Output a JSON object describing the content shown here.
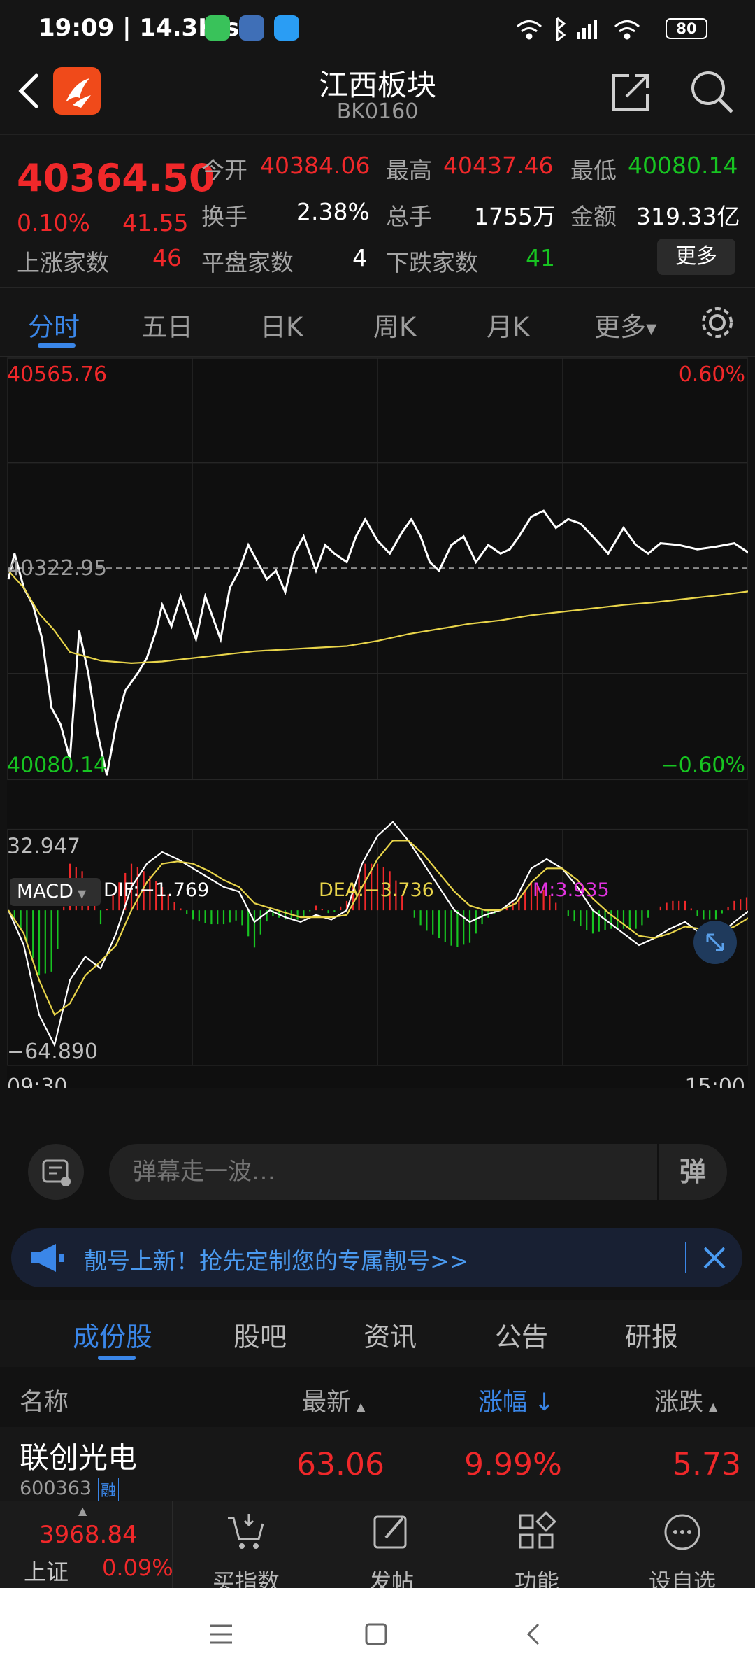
{
  "status_bar": {
    "time": "19:09 | 14.3K/s",
    "battery": "80"
  },
  "header": {
    "title": "江西板块",
    "code": "BK0160"
  },
  "quote": {
    "price": "40364.50",
    "change_pct": "0.10%",
    "change": "41.55",
    "open_label": "今开",
    "open": "40384.06",
    "high_label": "最高",
    "high": "40437.46",
    "low_label": "最低",
    "low": "40080.14",
    "turnover_label": "换手",
    "turnover": "2.38%",
    "volume_label": "总手",
    "volume": "1755万",
    "amount_label": "金额",
    "amount": "319.33亿",
    "up_label": "上涨家数",
    "up": "46",
    "flat_label": "平盘家数",
    "flat": "4",
    "down_label": "下跌家数",
    "down": "41",
    "more": "更多"
  },
  "kline_tabs": [
    "分时",
    "五日",
    "日K",
    "周K",
    "月K",
    "更多"
  ],
  "colors": {
    "up": "#f0282a",
    "down": "#17c421",
    "accent": "#3a86e8",
    "price_line": "#ffffff",
    "avg_line": "#e8d44a",
    "macd_m": "#e233e0"
  },
  "chart_data": {
    "type": "line",
    "title": "",
    "price_max_label": "40565.76",
    "price_min_label": "40080.14",
    "prev_close_label": "40322.95",
    "pct_max_label": "0.60%",
    "pct_min_label": "−0.60%",
    "ylim": [
      40080.14,
      40565.76
    ],
    "prev_close": 40322.95,
    "x_start_label": "09:30",
    "x_end_label": "15:00",
    "x_count": 241,
    "series": [
      {
        "kind": "price",
        "x": [
          0,
          2,
          5,
          8,
          11,
          14,
          17,
          20,
          23,
          26,
          29,
          32,
          35,
          38,
          42,
          45,
          48,
          50,
          53,
          56,
          58,
          61,
          64,
          66,
          69,
          72,
          75,
          78,
          81,
          84,
          87,
          90,
          93,
          96,
          100,
          103,
          106,
          110,
          113,
          116,
          120,
          124,
          128,
          131,
          134,
          137,
          140,
          144,
          148,
          152,
          156,
          160,
          163,
          166,
          170,
          174,
          178,
          182,
          186,
          190,
          195,
          200,
          204,
          208,
          212,
          218,
          224,
          230,
          236,
          241
        ],
        "values": [
          40310,
          40340,
          40300,
          40280,
          40240,
          40160,
          40140,
          40100,
          40250,
          40200,
          40130,
          40081,
          40140,
          40180,
          40200,
          40218,
          40250,
          40280,
          40255,
          40290,
          40270,
          40240,
          40290,
          40270,
          40240,
          40300,
          40320,
          40350,
          40330,
          40310,
          40320,
          40295,
          40340,
          40360,
          40320,
          40350,
          40340,
          40330,
          40360,
          40380,
          40355,
          40340,
          40365,
          40380,
          40360,
          40330,
          40320,
          40350,
          40360,
          40330,
          40350,
          40340,
          40345,
          40360,
          40383,
          40390,
          40370,
          40380,
          40375,
          40360,
          40340,
          40370,
          40350,
          40340,
          40352,
          40350,
          40345,
          40348,
          40352,
          40340
        ]
      },
      {
        "kind": "average",
        "x": [
          0,
          5,
          10,
          15,
          20,
          30,
          40,
          50,
          60,
          70,
          80,
          90,
          100,
          110,
          120,
          130,
          140,
          150,
          160,
          170,
          180,
          190,
          200,
          210,
          220,
          230,
          241
        ],
        "values": [
          40320,
          40300,
          40270,
          40250,
          40225,
          40215,
          40212,
          40214,
          40218,
          40222,
          40226,
          40228,
          40230,
          40232,
          40238,
          40246,
          40252,
          40258,
          40262,
          40268,
          40272,
          40276,
          40280,
          40283,
          40287,
          40291,
          40296
        ]
      }
    ],
    "macd": {
      "ind_name": "MACD",
      "dif_label": "DIF:−1.769",
      "dea_label": "DEA:−3.736",
      "m_label": "M:3.935",
      "max_label": "32.947",
      "min_label": "−64.890",
      "ylim": [
        -64.89,
        32.947
      ],
      "x": [
        0,
        5,
        10,
        15,
        20,
        25,
        30,
        35,
        40,
        45,
        50,
        55,
        60,
        65,
        70,
        75,
        80,
        85,
        90,
        95,
        100,
        105,
        110,
        115,
        120,
        125,
        130,
        135,
        140,
        145,
        150,
        155,
        160,
        165,
        170,
        175,
        180,
        185,
        190,
        195,
        200,
        205,
        210,
        215,
        220,
        225,
        230,
        236,
        241
      ],
      "dif": [
        0,
        -15,
        -45,
        -58,
        -30,
        -20,
        -25,
        -10,
        10,
        20,
        25,
        22,
        18,
        14,
        10,
        8,
        -5,
        0,
        -3,
        -5,
        -2,
        -4,
        0,
        20,
        32,
        38,
        30,
        20,
        10,
        0,
        -5,
        -2,
        0,
        5,
        18,
        22,
        18,
        10,
        0,
        -5,
        -10,
        -15,
        -12,
        -8,
        -5,
        -10,
        -12,
        -5,
        0
      ],
      "dea": [
        0,
        -10,
        -30,
        -45,
        -40,
        -28,
        -22,
        -15,
        0,
        12,
        20,
        21,
        20,
        17,
        13,
        10,
        3,
        1,
        -1,
        -3,
        -3,
        -3,
        -2,
        10,
        22,
        30,
        30,
        24,
        16,
        8,
        2,
        0,
        0,
        3,
        12,
        18,
        18,
        13,
        5,
        -1,
        -6,
        -11,
        -12,
        -10,
        -7,
        -8,
        -10,
        -7,
        -3
      ],
      "hist": [
        0,
        -10,
        -28,
        -26,
        20,
        16,
        -6,
        10,
        20,
        16,
        10,
        2,
        -4,
        -6,
        -6,
        -4,
        -16,
        -2,
        -4,
        -4,
        2,
        -2,
        4,
        20,
        20,
        16,
        0,
        -8,
        -12,
        -16,
        -14,
        -4,
        0,
        4,
        12,
        8,
        0,
        -6,
        -10,
        -8,
        -8,
        -8,
        0,
        4,
        4,
        -4,
        -4,
        4,
        6
      ]
    }
  },
  "chat": {
    "placeholder": "弹幕走一波…",
    "danmu_btn": "弹"
  },
  "banner": {
    "text": "靓号上新！抢先定制您的专属靓号>>"
  },
  "sub_tabs": [
    "成份股",
    "股吧",
    "资讯",
    "公告",
    "研报"
  ],
  "list": {
    "col_name": "名称",
    "col_latest": "最新",
    "col_change_pct": "涨幅",
    "col_change": "涨跌",
    "rows": [
      {
        "name": "联创光电",
        "code": "600363",
        "tag": "融",
        "latest": "63.06",
        "pct": "9.99%",
        "chg": "5.73"
      }
    ]
  },
  "bottom_nav": {
    "index_value": "3968.84",
    "index_name": "上证",
    "index_pct": "0.09%",
    "items": [
      "买指数",
      "发帖",
      "功能",
      "设自选"
    ]
  }
}
